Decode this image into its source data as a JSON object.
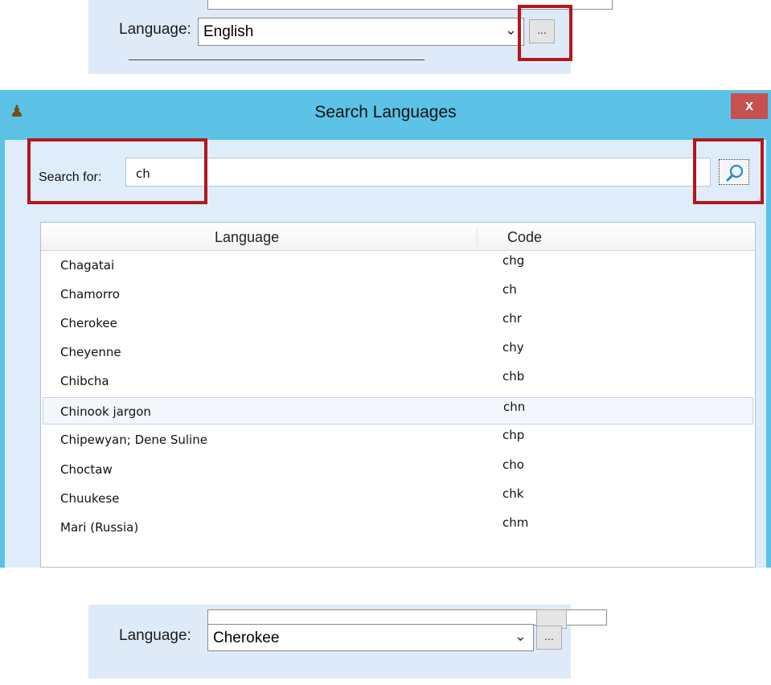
{
  "top_combo": {
    "label": "Language:",
    "value": "English",
    "ellipsis": "...",
    "chevron": "⌄"
  },
  "dialog": {
    "title": "Search Languages",
    "close_label": "x",
    "search_label": "Search for:",
    "search_value": "ch",
    "columns": [
      "Language",
      "Code"
    ],
    "rows": [
      {
        "language": "Chagatai",
        "code": "chg"
      },
      {
        "language": "Chamorro",
        "code": "ch"
      },
      {
        "language": "Cherokee",
        "code": "chr"
      },
      {
        "language": "Cheyenne",
        "code": "chy"
      },
      {
        "language": "Chibcha",
        "code": "chb"
      },
      {
        "language": "Chinook jargon",
        "code": "chn"
      },
      {
        "language": "Chipewyan; Dene Suline",
        "code": "chp"
      },
      {
        "language": "Choctaw",
        "code": "cho"
      },
      {
        "language": "Chuukese",
        "code": "chk"
      },
      {
        "language": "Mari (Russia)",
        "code": "chm"
      }
    ],
    "selected_row": "Chinook jargon"
  },
  "bottom_combo": {
    "label": "Language:",
    "value": "Cherokee",
    "ellipsis": "...",
    "chevron": "⌄"
  },
  "colors": {
    "titlebar": "#5cc2e6",
    "highlight": "#b3171c",
    "dialog_bg": "#dfecf9",
    "close": "#c75050"
  },
  "icons": {
    "app": "user-icon",
    "search": "magnifier-icon"
  }
}
